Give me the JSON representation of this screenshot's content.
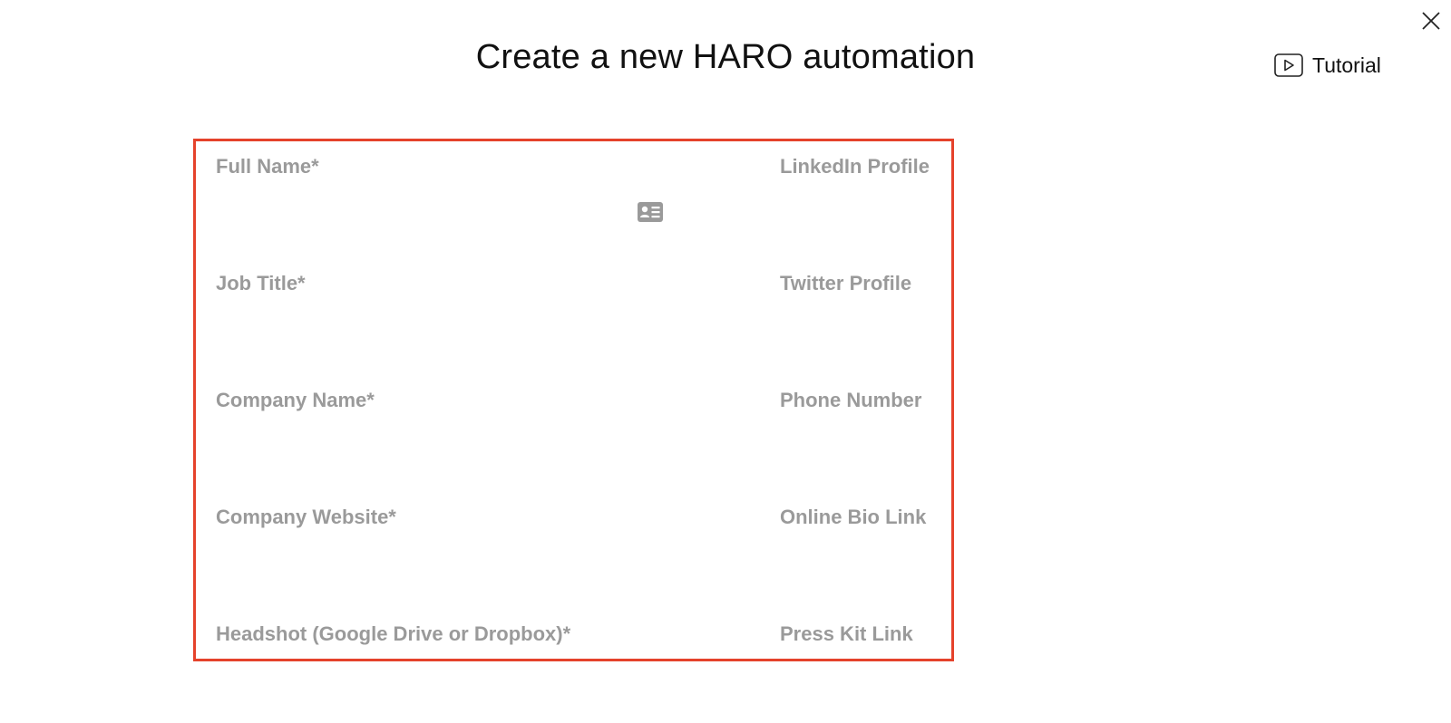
{
  "header": {
    "title": "Create a new HARO automation",
    "tutorial_label": "Tutorial"
  },
  "icons": {
    "close": "close-icon",
    "tutorial": "play-icon",
    "contact": "contact-card-icon"
  },
  "form": {
    "left_fields": [
      {
        "label": "Full Name*"
      },
      {
        "label": "Job Title*"
      },
      {
        "label": "Company Name*"
      },
      {
        "label": "Company Website*"
      },
      {
        "label": "Headshot (Google Drive or Dropbox)*"
      }
    ],
    "right_fields": [
      {
        "label": "LinkedIn Profile"
      },
      {
        "label": "Twitter Profile"
      },
      {
        "label": "Phone Number"
      },
      {
        "label": "Online Bio Link"
      },
      {
        "label": "Press Kit Link"
      }
    ]
  },
  "colors": {
    "highlight_border": "#e5422b",
    "label_text": "#9a9a9a",
    "title_text": "#111111"
  }
}
